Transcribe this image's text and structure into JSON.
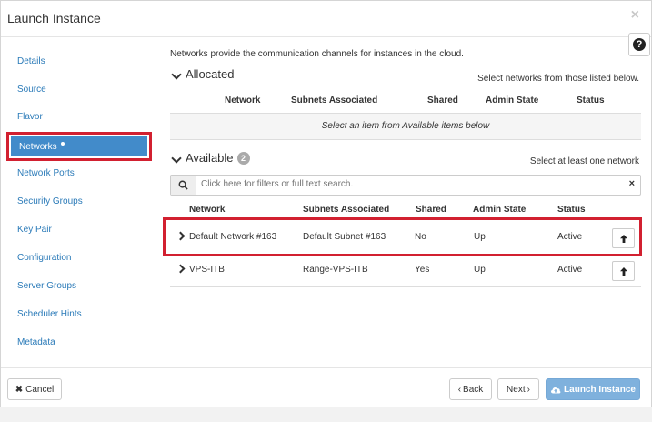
{
  "header": {
    "title": "Launch Instance",
    "close_glyph": "×",
    "help_glyph": "?"
  },
  "sidebar": {
    "items": [
      {
        "label": "Details"
      },
      {
        "label": "Source"
      },
      {
        "label": "Flavor"
      },
      {
        "label": "Networks",
        "active": true
      },
      {
        "label": "Network Ports"
      },
      {
        "label": "Security Groups"
      },
      {
        "label": "Key Pair"
      },
      {
        "label": "Configuration"
      },
      {
        "label": "Server Groups"
      },
      {
        "label": "Scheduler Hints"
      },
      {
        "label": "Metadata"
      }
    ]
  },
  "main": {
    "intro": "Networks provide the communication channels for instances in the cloud.",
    "allocated": {
      "title": "Allocated",
      "hint": "Select networks from those listed below.",
      "columns": [
        "Network",
        "Subnets Associated",
        "Shared",
        "Admin State",
        "Status"
      ],
      "empty_text": "Select an item from Available items below"
    },
    "available": {
      "title": "Available",
      "count": "2",
      "hint": "Select at least one network",
      "search_placeholder": "Click here for filters or full text search.",
      "search_clear": "×",
      "columns": [
        "Network",
        "Subnets Associated",
        "Shared",
        "Admin State",
        "Status"
      ],
      "rows": [
        {
          "network": "Default Network #163",
          "subnets": "Default Subnet #163",
          "shared": "No",
          "admin_state": "Up",
          "status": "Active"
        },
        {
          "network": "VPS-ITB",
          "subnets": "Range-VPS-ITB",
          "shared": "Yes",
          "admin_state": "Up",
          "status": "Active"
        }
      ]
    }
  },
  "footer": {
    "cancel_label": "Cancel",
    "back_label": "Back",
    "next_label": "Next",
    "launch_label": "Launch Instance"
  },
  "colors": {
    "accent": "#428bca",
    "highlight": "#d22030",
    "link": "#2a7ab8",
    "primary_disabled": "#7fb1dd"
  }
}
